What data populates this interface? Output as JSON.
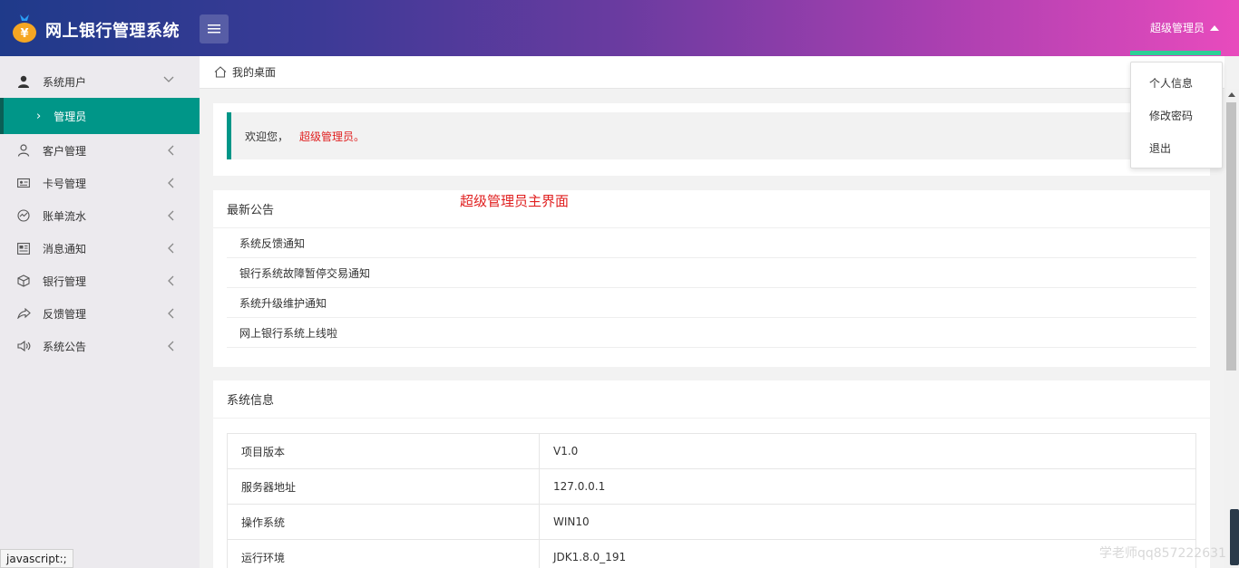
{
  "header": {
    "app_title": "网上银行管理系统",
    "user_label": "超级管理员",
    "accent_color": "#2ecf96"
  },
  "sidebar": {
    "items": [
      {
        "label": "系统用户",
        "icon": "user-solid-icon",
        "expanded": true
      },
      {
        "label": "客户管理",
        "icon": "user-outline-icon"
      },
      {
        "label": "卡号管理",
        "icon": "id-card-icon"
      },
      {
        "label": "账单流水",
        "icon": "chart-circle-icon"
      },
      {
        "label": "消息通知",
        "icon": "news-icon"
      },
      {
        "label": "银行管理",
        "icon": "box-icon"
      },
      {
        "label": "反馈管理",
        "icon": "share-icon"
      },
      {
        "label": "系统公告",
        "icon": "speaker-icon"
      }
    ],
    "active_sub": "管理员",
    "active_color": "#009688"
  },
  "breadcrumb": {
    "label": "我的桌面"
  },
  "welcome": {
    "greeting": "欢迎您，",
    "name": "超级管理员。"
  },
  "overlay_caption": "超级管理员主界面",
  "notices": {
    "title": "最新公告",
    "items": [
      "系统反馈通知",
      "银行系统故障暂停交易通知",
      "系统升级维护通知",
      "网上银行系统上线啦"
    ]
  },
  "system_info": {
    "title": "系统信息",
    "rows": [
      {
        "key": "项目版本",
        "value": "V1.0"
      },
      {
        "key": "服务器地址",
        "value": "127.0.0.1"
      },
      {
        "key": "操作系统",
        "value": "WIN10"
      },
      {
        "key": "运行环境",
        "value": "JDK1.8.0_191"
      }
    ]
  },
  "dropdown": {
    "items": [
      "个人信息",
      "修改密码",
      "退出"
    ]
  },
  "status_bar": "javascript:;",
  "watermark": "学老师qq857222631"
}
